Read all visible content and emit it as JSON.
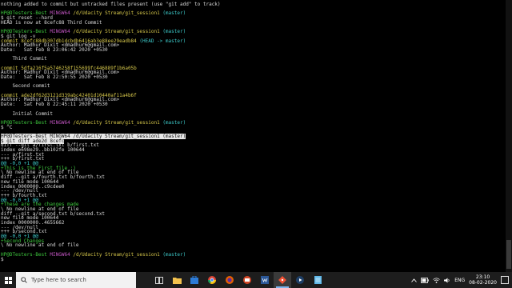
{
  "terminal": {
    "lines": [
      [
        {
          "t": "nothing added to commit but untracked files present (use \"git add\" to track)",
          "c": "w"
        }
      ],
      [
        {
          "t": "",
          "c": "w"
        }
      ],
      [
        {
          "t": "HP@DTesters-Best ",
          "c": "g"
        },
        {
          "t": "MINGW64 ",
          "c": "m"
        },
        {
          "t": "/d/Udacity Stream/git_session1 ",
          "c": "y"
        },
        {
          "t": "(master)",
          "c": "c"
        }
      ],
      [
        {
          "t": "$ git reset --hard",
          "c": "w"
        }
      ],
      [
        {
          "t": "HEAD is now at 8cefc88 Third Commit",
          "c": "w"
        }
      ],
      [
        {
          "t": "",
          "c": "w"
        }
      ],
      [
        {
          "t": "HP@DTesters-Best ",
          "c": "g"
        },
        {
          "t": "MINGW64 ",
          "c": "m"
        },
        {
          "t": "/d/Udacity Stream/git_session1 ",
          "c": "y"
        },
        {
          "t": "(master)",
          "c": "c"
        }
      ],
      [
        {
          "t": "$ git log -v",
          "c": "w"
        }
      ],
      [
        {
          "t": "commit 8cefc88db307db1dcbdb6416ab3e88ee29eadb84 ",
          "c": "y"
        },
        {
          "t": "(HEAD -> master)",
          "c": "c"
        }
      ],
      [
        {
          "t": "Author: Madhur Dixit <dmadhur6@gmail.com>",
          "c": "w"
        }
      ],
      [
        {
          "t": "Date:   Sat Feb 8 23:06:42 2020 +0530",
          "c": "w"
        }
      ],
      [
        {
          "t": "",
          "c": "w"
        }
      ],
      [
        {
          "t": "    Third Commit",
          "c": "w"
        }
      ],
      [
        {
          "t": "",
          "c": "w"
        }
      ],
      [
        {
          "t": "commit 5dfa216f5a5746258f155699fc446889f1b6a05b",
          "c": "y"
        }
      ],
      [
        {
          "t": "Author: Madhur Dixit <dmadhur6@gmail.com>",
          "c": "w"
        }
      ],
      [
        {
          "t": "Date:   Sat Feb 8 22:50:55 2020 +0530",
          "c": "w"
        }
      ],
      [
        {
          "t": "",
          "c": "w"
        }
      ],
      [
        {
          "t": "    Second commit",
          "c": "w"
        }
      ],
      [
        {
          "t": "",
          "c": "w"
        }
      ],
      [
        {
          "t": "commit ade2df62d3121d339abc42401d10440af11a4b6f",
          "c": "y"
        }
      ],
      [
        {
          "t": "Author: Madhur Dixit <dmadhur6@gmail.com>",
          "c": "w"
        }
      ],
      [
        {
          "t": "Date:   Sat Feb 8 22:45:11 2020 +0530",
          "c": "w"
        }
      ],
      [
        {
          "t": "",
          "c": "w"
        }
      ],
      [
        {
          "t": "    Initial Commit",
          "c": "w"
        }
      ],
      [
        {
          "t": "",
          "c": "w"
        }
      ],
      [
        {
          "t": "HP@DTesters-Best ",
          "c": "g"
        },
        {
          "t": "MINGW64 ",
          "c": "m"
        },
        {
          "t": "/d/Udacity Stream/git_session1 ",
          "c": "y"
        },
        {
          "t": "(master)",
          "c": "c"
        }
      ],
      [
        {
          "t": "$ ^C",
          "c": "w"
        }
      ],
      [
        {
          "t": "",
          "c": "w"
        }
      ],
      [
        {
          "t": "HP@DTesters-Best MINGW64 /d/Udacity Stream/git_session1 (master)",
          "c": "sel"
        }
      ],
      [
        {
          "t": "$ git diff ade2d 8cefc",
          "c": "sel"
        }
      ],
      [
        {
          "t": "diff --git a/first.txt b/first.txt",
          "c": "w"
        }
      ],
      [
        {
          "t": "index e698e29..bb102fe 100644",
          "c": "w"
        }
      ],
      [
        {
          "t": "--- a/first.txt",
          "c": "w"
        }
      ],
      [
        {
          "t": "+++ b/first.txt",
          "c": "w"
        }
      ],
      [
        {
          "t": "@@ -0,0 +1 @@",
          "c": "c"
        }
      ],
      [
        {
          "t": "+This is the First file :)",
          "c": "g"
        }
      ],
      [
        {
          "t": "\\ No newline at end of file",
          "c": "w"
        }
      ],
      [
        {
          "t": "diff --git a/fourth.txt b/fourth.txt",
          "c": "w"
        }
      ],
      [
        {
          "t": "new file mode 100644",
          "c": "w"
        }
      ],
      [
        {
          "t": "index 0000000..c9cdee0",
          "c": "w"
        }
      ],
      [
        {
          "t": "--- /dev/null",
          "c": "w"
        }
      ],
      [
        {
          "t": "+++ b/fourth.txt",
          "c": "w"
        }
      ],
      [
        {
          "t": "@@ -0,0 +1 @@",
          "c": "c"
        }
      ],
      [
        {
          "t": "+These are the changes made",
          "c": "g"
        }
      ],
      [
        {
          "t": "\\ No newline at end of file",
          "c": "w"
        }
      ],
      [
        {
          "t": "diff --git a/second.txt b/second.txt",
          "c": "w"
        }
      ],
      [
        {
          "t": "new file mode 100644",
          "c": "w"
        }
      ],
      [
        {
          "t": "index 0000000..4655662",
          "c": "w"
        }
      ],
      [
        {
          "t": "--- /dev/null",
          "c": "w"
        }
      ],
      [
        {
          "t": "+++ b/second.txt",
          "c": "w"
        }
      ],
      [
        {
          "t": "@@ -0,0 +1 @@",
          "c": "c"
        }
      ],
      [
        {
          "t": "+Second Changes",
          "c": "g"
        }
      ],
      [
        {
          "t": "\\ No newline at end of file",
          "c": "w"
        }
      ],
      [
        {
          "t": "",
          "c": "w"
        }
      ],
      [
        {
          "t": "HP@DTesters-Best ",
          "c": "g"
        },
        {
          "t": "MINGW64 ",
          "c": "m"
        },
        {
          "t": "/d/Udacity Stream/git_session1 ",
          "c": "y"
        },
        {
          "t": "(master)",
          "c": "c"
        }
      ],
      [
        {
          "t": "$",
          "c": "w"
        }
      ]
    ]
  },
  "taskbar": {
    "search_placeholder": "Type here to search",
    "apps": [
      "task-view-icon",
      "file-explorer-icon",
      "store-icon",
      "chrome-icon",
      "firefox-icon",
      "powerpoint-icon",
      "word-icon",
      "git-bash-icon",
      "media-icon",
      "notepad-icon"
    ],
    "language": "ENG",
    "time": "23:10",
    "date": "08-02-2020"
  },
  "colors": {
    "prompt_user": "#3ec83e",
    "prompt_host": "#c054c0",
    "prompt_path": "#d6c74a",
    "prompt_branch": "#3cc8c8",
    "taskbar": "#1d1d1d"
  }
}
